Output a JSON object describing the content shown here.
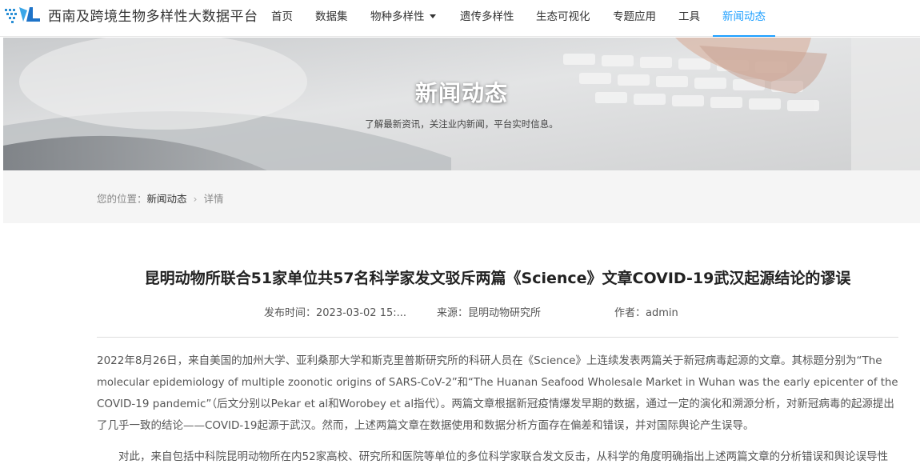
{
  "header": {
    "site_title": "西南及跨境生物多样性大数据平台",
    "nav": [
      {
        "label": "首页"
      },
      {
        "label": "数据集"
      },
      {
        "label": "物种多样性",
        "has_dropdown": true
      },
      {
        "label": "遗传多样性"
      },
      {
        "label": "生态可视化"
      },
      {
        "label": "专题应用"
      },
      {
        "label": "工具"
      },
      {
        "label": "新闻动态",
        "active": true
      }
    ],
    "accent_color": "#1e9fff"
  },
  "banner": {
    "title": "新闻动态",
    "subtitle": "了解最新资讯，关注业内新闻，平台实时信息。"
  },
  "breadcrumb": {
    "prefix": "您的位置：",
    "section": "新闻动态",
    "current": "详情"
  },
  "article": {
    "title": "昆明动物所联合51家单位共57名科学家发文驳斥两篇《Science》文章COVID-19武汉起源结论的谬误",
    "meta": {
      "publish_label": "发布时间：",
      "publish_time": "2023-03-02 15:...",
      "source_label": "来源：",
      "source": "昆明动物研究所",
      "author_label": "作者：",
      "author": "admin"
    },
    "paragraphs": [
      {
        "lines": [
          "2022年8月26日，来自美国的加州大学、亚利桑那大学和斯克里普斯研究所的科研人员在《Science》上连续发表两篇关于新冠病毒起源的文章。其标题分别为“The",
          "molecular epidemiology of multiple zoonotic origins of SARS-CoV-2”和“The Huanan Seafood Wholesale Market in Wuhan was the early epicenter of the",
          "COVID-19 pandemic”（后文分别以Pekar et al和Worobey et al指代）。两篇文章根据新冠疫情爆发早期的数据，通过一定的演化和溯源分析，对新冠病毒的起源提出",
          "了几乎一致的结论——COVID-19起源于武汉。然而，上述两篇文章在数据使用和数据分析方面存在偏差和错误，并对国际舆论产生误导。"
        ]
      },
      {
        "lines": [
          "对此，来自包括中科院昆明动物所在内52家高校、研究所和医院等单位的多位科学家联合发文反击，从科学的角度明确指出上述两篇文章的分析错误和舆论误导性"
        ]
      }
    ]
  }
}
